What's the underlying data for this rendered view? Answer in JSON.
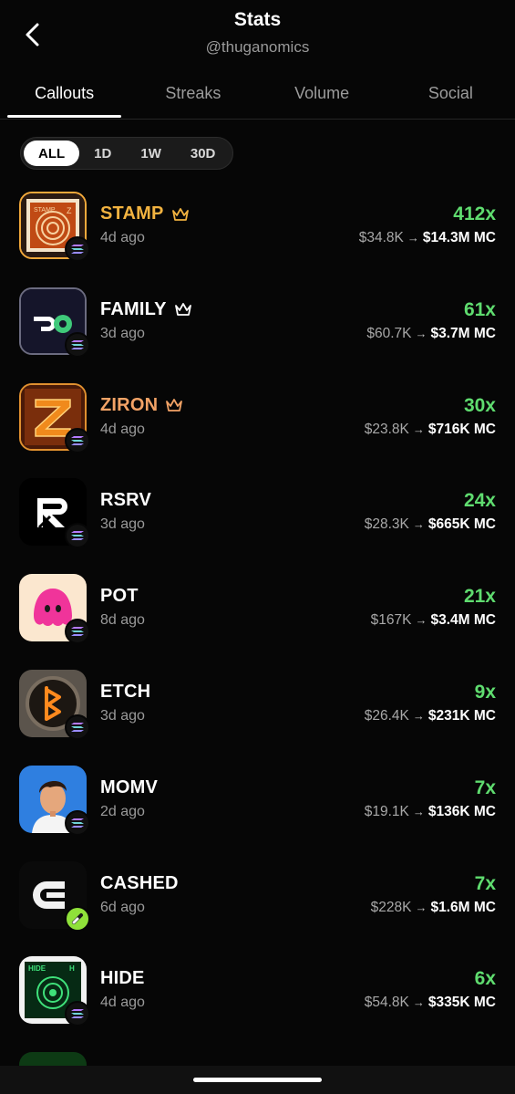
{
  "header": {
    "title": "Stats",
    "handle": "@thuganomics"
  },
  "tabs": [
    "Callouts",
    "Streaks",
    "Volume",
    "Social"
  ],
  "filters": [
    "ALL",
    "1D",
    "1W",
    "30D"
  ],
  "active_filter": "ALL",
  "calls": [
    {
      "name": "STAMP",
      "crown": true,
      "age": "4d ago",
      "multiple": "412x",
      "from": "$34.8K",
      "to": "$14.3M",
      "unit": "MC",
      "chain": "solana"
    },
    {
      "name": "FAMILY",
      "crown": true,
      "age": "3d ago",
      "multiple": "61x",
      "from": "$60.7K",
      "to": "$3.7M",
      "unit": "MC",
      "chain": "solana"
    },
    {
      "name": "ZIRON",
      "crown": true,
      "age": "4d ago",
      "multiple": "30x",
      "from": "$23.8K",
      "to": "$716K",
      "unit": "MC",
      "chain": "solana"
    },
    {
      "name": "RSRV",
      "crown": false,
      "age": "3d ago",
      "multiple": "24x",
      "from": "$28.3K",
      "to": "$665K",
      "unit": "MC",
      "chain": "solana"
    },
    {
      "name": "POT",
      "crown": false,
      "age": "8d ago",
      "multiple": "21x",
      "from": "$167K",
      "to": "$3.4M",
      "unit": "MC",
      "chain": "solana"
    },
    {
      "name": "ETCH",
      "crown": false,
      "age": "3d ago",
      "multiple": "9x",
      "from": "$26.4K",
      "to": "$231K",
      "unit": "MC",
      "chain": "solana"
    },
    {
      "name": "MOMV",
      "crown": false,
      "age": "2d ago",
      "multiple": "7x",
      "from": "$19.1K",
      "to": "$136K",
      "unit": "MC",
      "chain": "solana"
    },
    {
      "name": "CASHED",
      "crown": false,
      "age": "6d ago",
      "multiple": "7x",
      "from": "$228K",
      "to": "$1.6M",
      "unit": "MC",
      "chain": "pump"
    },
    {
      "name": "HIDE",
      "crown": false,
      "age": "4d ago",
      "multiple": "6x",
      "from": "$54.8K",
      "to": "$335K",
      "unit": "MC",
      "chain": "solana"
    }
  ],
  "colors": {
    "background": "#060606",
    "gain": "#5fdc6f",
    "gold": "#f2b340",
    "muted": "#9a9a9a"
  }
}
